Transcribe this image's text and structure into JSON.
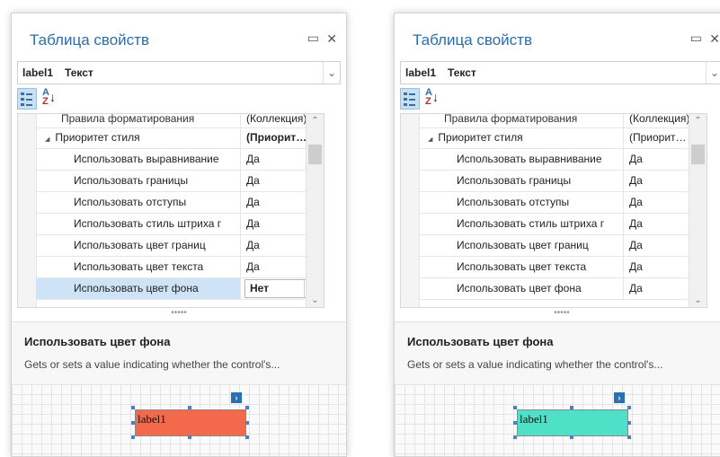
{
  "panels": [
    {
      "title": "Таблица свойств",
      "object_name": "label1",
      "object_type": "Текст",
      "top_row": {
        "name": "Правила форматирования",
        "value": "(Коллекция)"
      },
      "category": {
        "expander": "◢",
        "name": "Приоритет стиля",
        "value": "(Приорит…"
      },
      "rows": [
        {
          "name": "Использовать выравнивание",
          "value": "Да"
        },
        {
          "name": "Использовать границы",
          "value": "Да"
        },
        {
          "name": "Использовать отступы",
          "value": "Да"
        },
        {
          "name": "Использовать стиль штриха г",
          "value": "Да"
        },
        {
          "name": "Использовать цвет границ",
          "value": "Да"
        },
        {
          "name": "Использовать цвет текста",
          "value": "Да"
        }
      ],
      "selected_row": {
        "name": "Использовать цвет фона",
        "value": "Нет"
      },
      "description": {
        "title": "Использовать цвет фона",
        "text": "Gets or sets a value indicating whether the control's..."
      },
      "designer": {
        "label_text": "label1",
        "label_color": "#f26a4b",
        "smart_tag": "›"
      }
    },
    {
      "title": "Таблица свойств",
      "object_name": "label1",
      "object_type": "Текст",
      "top_row": {
        "name": "Правила форматирования",
        "value": "(Коллекция)"
      },
      "category": {
        "expander": "◢",
        "name": "Приоритет стиля",
        "value": "(Приорит…"
      },
      "rows": [
        {
          "name": "Использовать выравнивание",
          "value": "Да"
        },
        {
          "name": "Использовать границы",
          "value": "Да"
        },
        {
          "name": "Использовать отступы",
          "value": "Да"
        },
        {
          "name": "Использовать стиль штриха г",
          "value": "Да"
        },
        {
          "name": "Использовать цвет границ",
          "value": "Да"
        },
        {
          "name": "Использовать цвет текста",
          "value": "Да"
        },
        {
          "name": "Использовать цвет фона",
          "value": "Да"
        }
      ],
      "description": {
        "title": "Использовать цвет фона",
        "text": "Gets or sets a value indicating whether the control's..."
      },
      "designer": {
        "label_text": "label1",
        "label_color": "#4fe0c8",
        "smart_tag": "›"
      }
    }
  ],
  "window_buttons": {
    "minimize": "▭",
    "close": "✕"
  },
  "icons": {
    "dropdown": "⌄",
    "scroll_up": "⌃",
    "scroll_down": "⌄",
    "sort_arrow": "↓",
    "sort_a": "A",
    "sort_z": "Z",
    "splitter": "•••••"
  }
}
